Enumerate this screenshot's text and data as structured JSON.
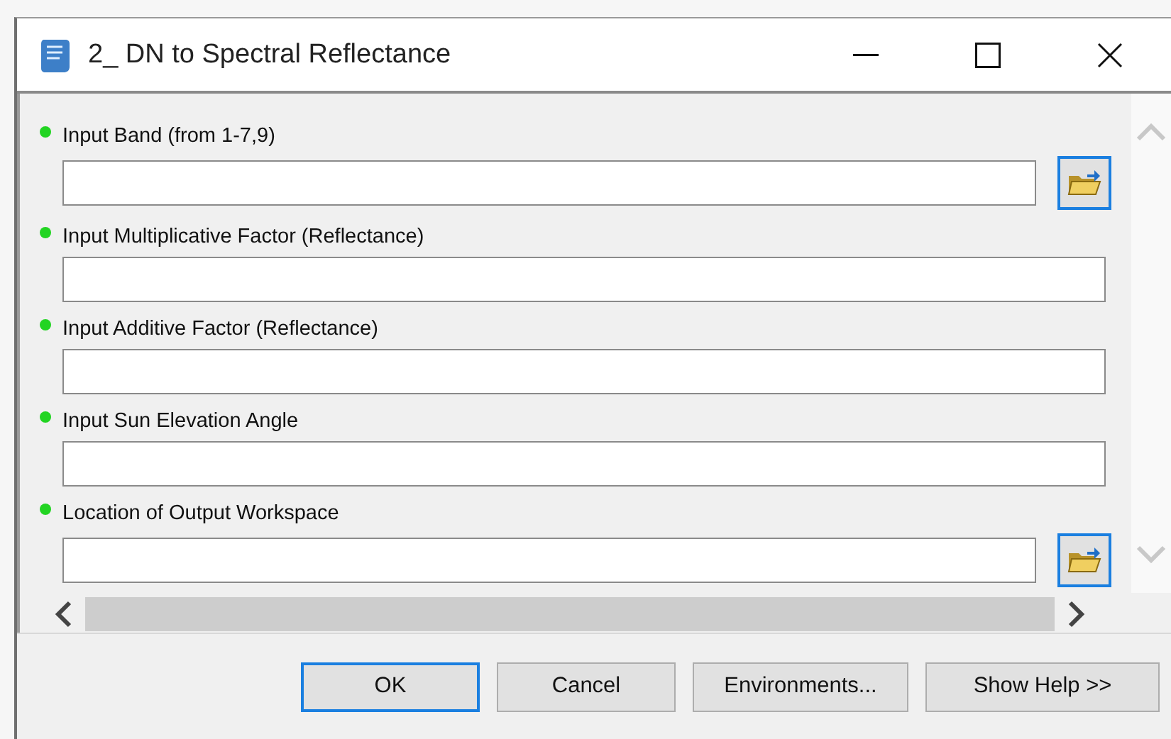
{
  "window": {
    "title": "2_ DN to Spectral Reflectance"
  },
  "parameters": [
    {
      "label": "Input Band (from 1-7,9)",
      "kind": "file"
    },
    {
      "label": "Input Multiplicative Factor (Reflectance)",
      "kind": "text"
    },
    {
      "label": "Input Additive Factor (Reflectance)",
      "kind": "text"
    },
    {
      "label": "Input Sun Elevation Angle",
      "kind": "text"
    },
    {
      "label": "Location of Output Workspace",
      "kind": "file"
    }
  ],
  "buttons": [
    {
      "label": "OK",
      "default": true
    },
    {
      "label": "Cancel",
      "default": false
    },
    {
      "label": "Environments...",
      "default": false
    },
    {
      "label": "Show Help >>",
      "default": false
    }
  ]
}
